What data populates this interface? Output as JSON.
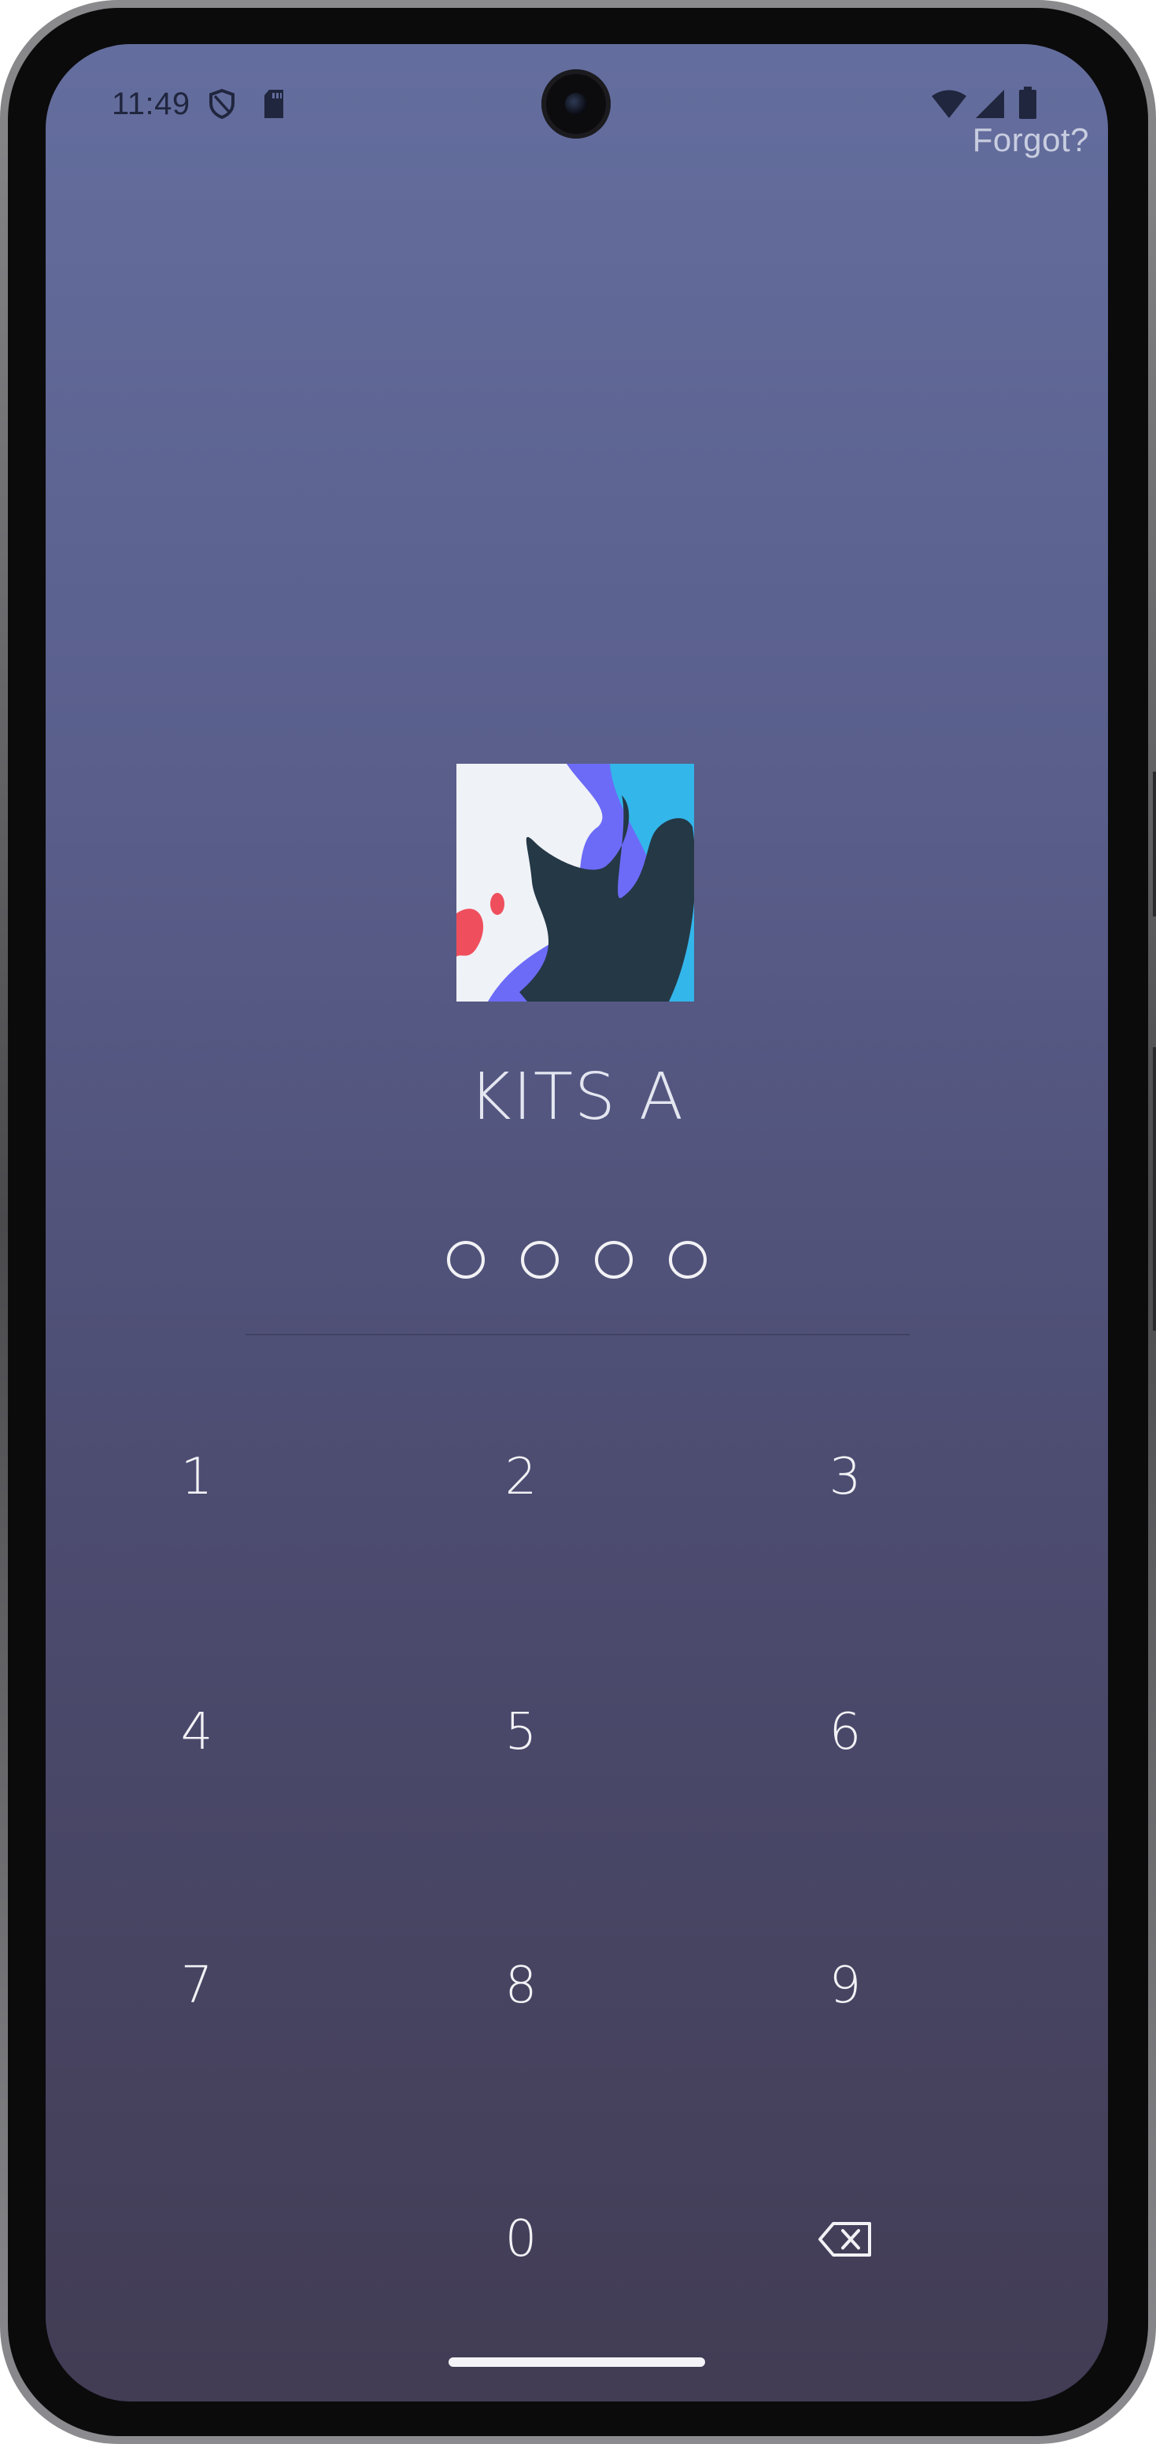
{
  "status_bar": {
    "time": "11:49",
    "left_icons": [
      "shield-icon",
      "sd-card-icon"
    ],
    "right_icons": [
      "wifi-icon",
      "cell-signal-icon",
      "battery-icon"
    ]
  },
  "header": {
    "forgot_label": "Forgot?"
  },
  "profile": {
    "name": "KITS A",
    "avatar_icon": "abstract-avatar-image"
  },
  "pin": {
    "length": 4,
    "entered": 0
  },
  "keypad": {
    "keys": [
      "1",
      "2",
      "3",
      "4",
      "5",
      "6",
      "7",
      "8",
      "9",
      "0"
    ],
    "backspace_icon": "backspace-icon"
  },
  "colors": {
    "background_top": "#646e9e",
    "background_bottom": "#423c54",
    "text": "#f2f2f6"
  }
}
